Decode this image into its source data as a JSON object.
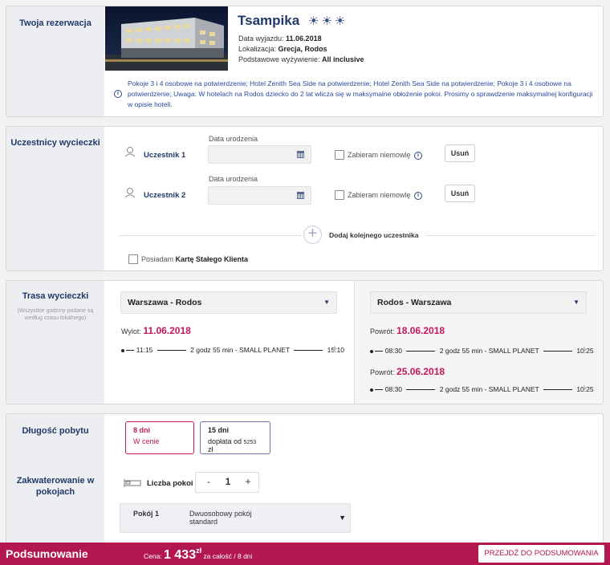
{
  "reservation": {
    "section_title": "Twoja rezerwacja",
    "hotel_name": "Tsampika",
    "rating_icons": "☀☀☀",
    "departure_label": "Data wyjazdu: ",
    "departure_value": "11.06.2018",
    "location_label": "Lokalizacja: ",
    "location_value": "Grecja, Rodos",
    "board_label": "Podstawowe wyżywienie: ",
    "board_value": "All inclusive",
    "notice": "Pokoje 3 i 4 osobowe na potwierdzenie; Hotel Zenith Sea Side na potwierdzenie; Hotel Zenith Sea Side na potwierdzenie; Pokoje 3 i 4 osobowe na potwierdzenie; Uwaga: W hotelach na Rodos dziecko do 2 lat wlicza się w maksymalne obłożenie pokoi. Prosimy o sprawdzenie maksymalnej konfiguracji w opisie hoteli."
  },
  "participants": {
    "section_title": "Uczestnicy wycieczki",
    "list": [
      {
        "label": "Uczestnik 1",
        "dob_label": "Data urodzenia",
        "dob_value": "",
        "infant_label": "Zabieram niemowlę",
        "remove_label": "Usuń"
      },
      {
        "label": "Uczestnik 2",
        "dob_label": "Data urodzenia",
        "dob_value": "",
        "infant_label": "Zabieram niemowlę",
        "remove_label": "Usuń"
      }
    ],
    "add_label": "Dodaj kolejnego uczestnika",
    "card_prefix": "Posiadam ",
    "card_bold": "Kartę Stałego Klienta"
  },
  "route": {
    "section_title": "Trasa wycieczki",
    "section_note": "(Wszystkie godziny podane są według czasu lokalnego)",
    "outbound": {
      "select_value": "Warszawa - Rodos",
      "date_label": "Wylot: ",
      "date": "11.06.2018",
      "dep_time": "11:15",
      "duration": "2 godz 55 min - SMALL PLANET",
      "arr_time": "15:10"
    },
    "inbound": {
      "select_value": "Rodos - Warszawa",
      "options": [
        {
          "date_label": "Powrót: ",
          "date": "18.06.2018",
          "dep_time": "08:30",
          "duration": "2 godz 55 min - SMALL PLANET",
          "arr_time": "10:25"
        },
        {
          "date_label": "Powrót: ",
          "date": "25.06.2018",
          "dep_time": "08:30",
          "duration": "2 godz 55 min - SMALL PLANET",
          "arr_time": "10:25"
        }
      ]
    }
  },
  "stay": {
    "section_title": "Długość pobytu",
    "options": [
      {
        "title": "8 dni",
        "sub": "W cenie",
        "selected": true
      },
      {
        "title": "15 dni",
        "sub_prefix": "dopłata od ",
        "sub_amount": "5253",
        "sub_suffix": " zł",
        "selected": false
      }
    ]
  },
  "accommodation": {
    "section_title": "Zakwaterowanie w pokojach",
    "rooms_label": "Liczba pokoi",
    "rooms_count": "1",
    "minus": "-",
    "plus": "+",
    "room_label": "Pokój 1",
    "room_type": "Dwuosobowy pokój standard"
  },
  "summary": {
    "title": "Podsumowanie",
    "price_label": "Cena: ",
    "price_value": "1 433",
    "currency": "zł",
    "price_suffix": " za całość / 8 dni",
    "button_label": "PRZEJDŹ DO PODSUMOWANIA"
  },
  "colors": {
    "accent": "#b3174f",
    "navy": "#1f3a68",
    "date_pink": "#c2185b"
  }
}
